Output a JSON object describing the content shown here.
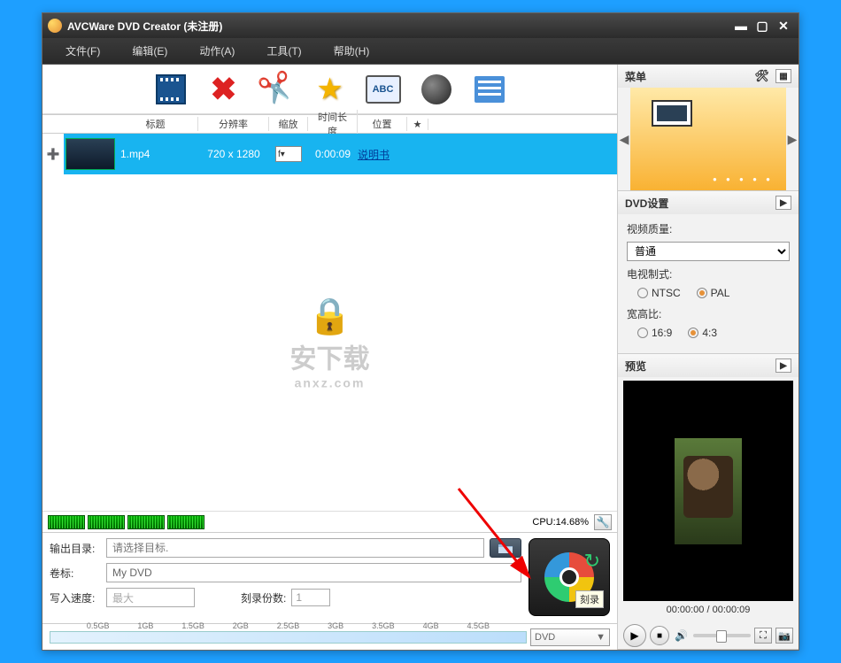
{
  "title": "AVCWare DVD Creator (未注册)",
  "menu": {
    "file": "文件(F)",
    "edit": "编辑(E)",
    "action": "动作(A)",
    "tools": "工具(T)",
    "help": "帮助(H)"
  },
  "columns": {
    "title": "标题",
    "resolution": "分辨率",
    "zoom": "缩放",
    "duration": "时间长度",
    "position": "位置",
    "star": "★"
  },
  "row": {
    "title": "1.mp4",
    "resolution": "720 x 1280",
    "zoom": "f",
    "duration": "0:00:09",
    "position": "说明书"
  },
  "watermark": {
    "main": "安下载",
    "sub": "anxz.com"
  },
  "cpu": "CPU:14.68%",
  "output": {
    "dir_label": "输出目录:",
    "dir_placeholder": "请选择目标.",
    "vol_label": "卷标:",
    "vol_value": "My DVD",
    "speed_label": "写入速度:",
    "speed_value": "最大",
    "copies_label": "刻录份数:",
    "copies_value": "1"
  },
  "burn_label": "刻录",
  "scale": {
    "ticks": [
      "0.5GB",
      "1GB",
      "1.5GB",
      "2GB",
      "2.5GB",
      "3GB",
      "3.5GB",
      "4GB",
      "4.5GB"
    ],
    "format": "DVD"
  },
  "side": {
    "menu_title": "菜单",
    "dvd_title": "DVD设置",
    "quality_label": "视频质量:",
    "quality_value": "普通",
    "tv_label": "电视制式:",
    "tv_ntsc": "NTSC",
    "tv_pal": "PAL",
    "aspect_label": "宽高比:",
    "aspect_169": "16:9",
    "aspect_43": "4:3",
    "preview_title": "预览",
    "time": "00:00:00 / 00:00:09"
  }
}
